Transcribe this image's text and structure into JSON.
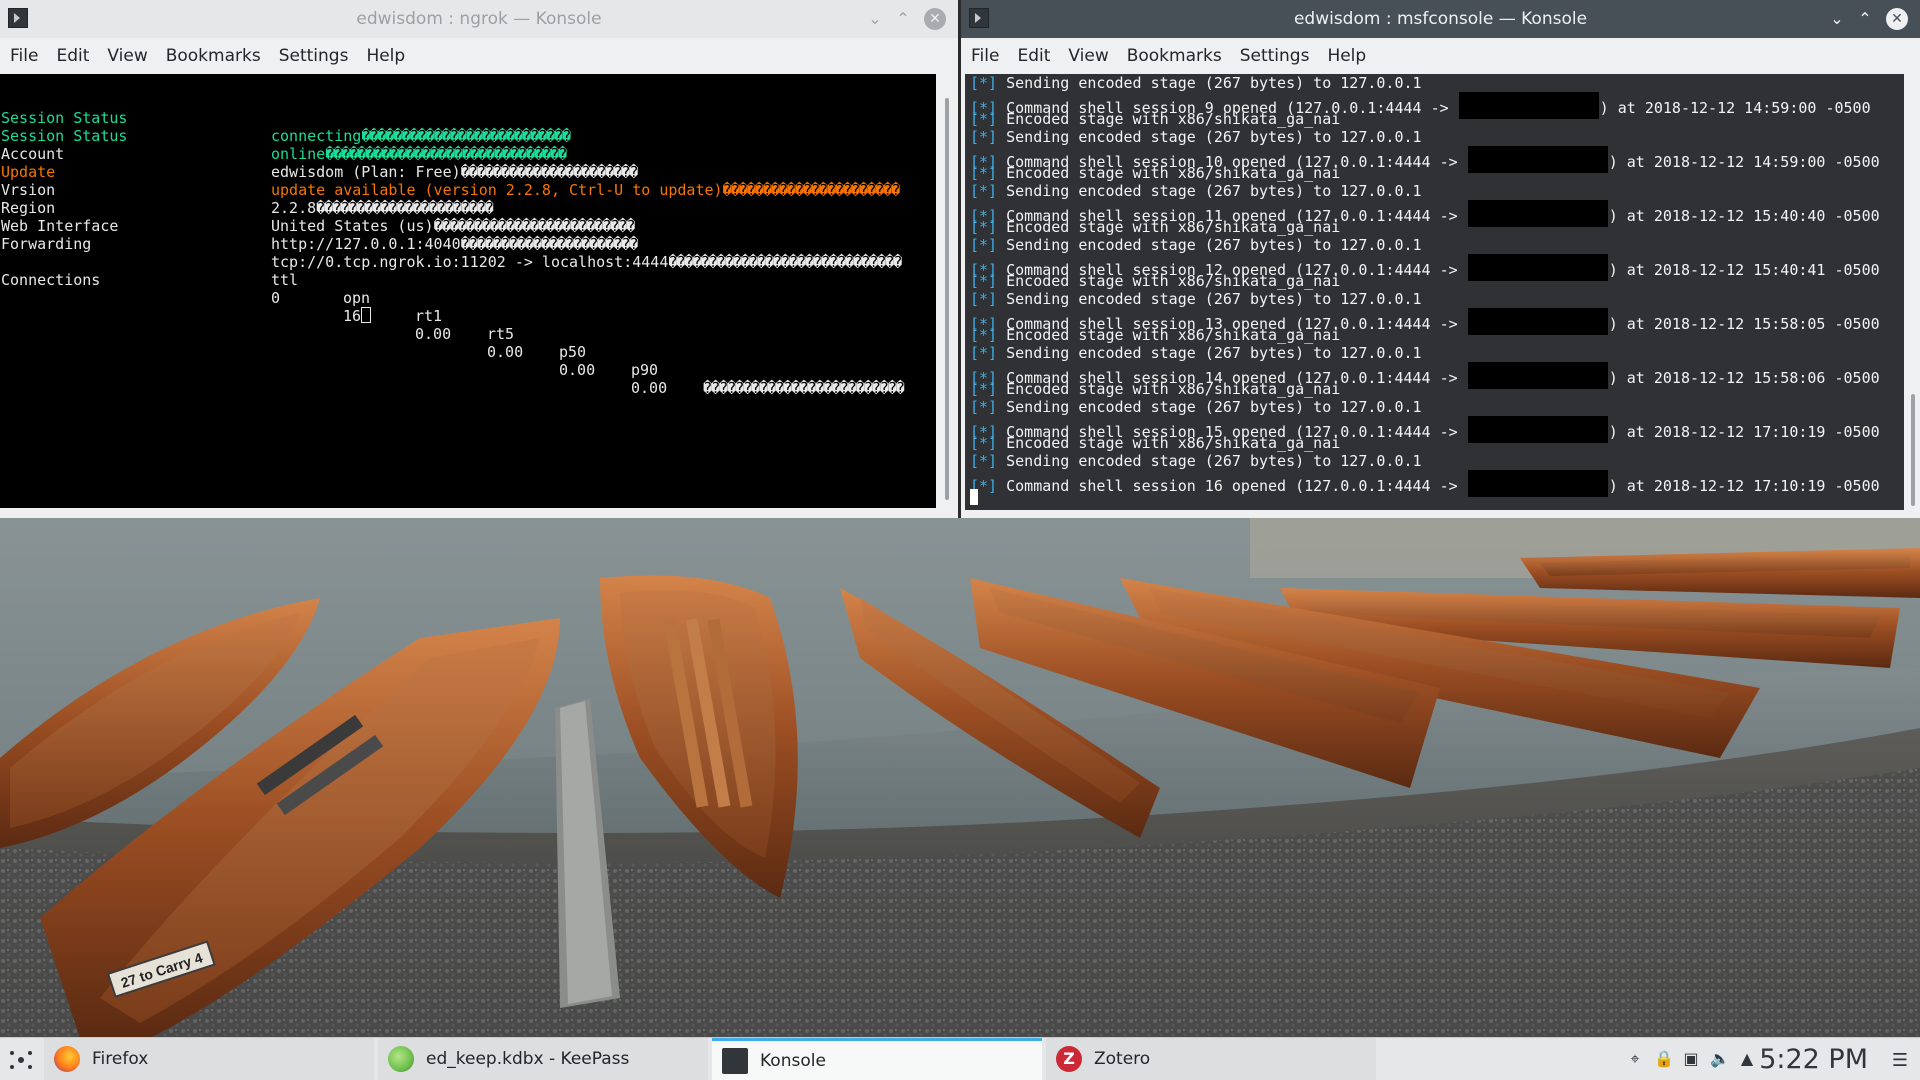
{
  "left_window": {
    "title": "edwisdom : ngrok — Konsole",
    "menu": [
      "File",
      "Edit",
      "View",
      "Bookmarks",
      "Settings",
      "Help"
    ],
    "ngrok": {
      "rows": [
        {
          "label": "Session Status",
          "value": "connecting",
          "fill": "��������������������������",
          "style": "green"
        },
        {
          "label": "Session Status",
          "value": "online",
          "fill": "������������������������������",
          "style": "green"
        },
        {
          "label": "Account",
          "value": "edwisdom (Plan: Free)",
          "fill": "����������������������",
          "style": "normal"
        },
        {
          "label": "Update",
          "value": "update available (version 2.2.8, Ctrl-U to update)",
          "fill": "����������������������",
          "style": "orange"
        },
        {
          "label": "Vrsion",
          "value": "2.2.8",
          "fill": "����������������������",
          "style": "normal"
        },
        {
          "label": "Region",
          "value": "United States (us)",
          "fill": "�������������������������",
          "style": "normal"
        },
        {
          "label": "Web Interface",
          "value": "http://127.0.0.1:4040",
          "fill": "����������������������",
          "style": "normal"
        },
        {
          "label": "Forwarding",
          "value": "tcp://0.tcp.ngrok.io:11202 -> localhost:4444",
          "fill": "�����������������������������",
          "style": "normal"
        }
      ],
      "connections_label": "Connections",
      "conn_headers": [
        "ttl",
        "opn",
        "rt1",
        "rt5",
        "p50",
        "p90"
      ],
      "conn_tail": "�������������������������",
      "conn_values": [
        "0",
        "16",
        "0.00",
        "0.00",
        "0.00",
        "0.00"
      ]
    }
  },
  "right_window": {
    "title": "edwisdom : msfconsole — Konsole",
    "menu": [
      "File",
      "Edit",
      "View",
      "Bookmarks",
      "Settings",
      "Help"
    ],
    "marker": "[*]",
    "lines": [
      {
        "text": "Sending encoded stage (267 bytes) to 127.0.0.1"
      },
      {
        "text": "Command shell session 9 opened (127.0.0.1:4444 ->",
        "tail": ") at 2018-12-12 14:59:00 -0500"
      },
      {
        "text": "Encoded stage with x86/shikata_ga_nai"
      },
      {
        "text": "Sending encoded stage (267 bytes) to 127.0.0.1"
      },
      {
        "text": "Command shell session 10 opened (127.0.0.1:4444 ->",
        "tail": ") at 2018-12-12 14:59:00 -0500"
      },
      {
        "text": "Encoded stage with x86/shikata_ga_nai"
      },
      {
        "text": "Sending encoded stage (267 bytes) to 127.0.0.1"
      },
      {
        "text": "Command shell session 11 opened (127.0.0.1:4444 ->",
        "tail": ") at 2018-12-12 15:40:40 -0500"
      },
      {
        "text": "Encoded stage with x86/shikata_ga_nai"
      },
      {
        "text": "Sending encoded stage (267 bytes) to 127.0.0.1"
      },
      {
        "text": "Command shell session 12 opened (127.0.0.1:4444 ->",
        "tail": ") at 2018-12-12 15:40:41 -0500"
      },
      {
        "text": "Encoded stage with x86/shikata_ga_nai"
      },
      {
        "text": "Sending encoded stage (267 bytes) to 127.0.0.1"
      },
      {
        "text": "Command shell session 13 opened (127.0.0.1:4444 ->",
        "tail": ") at 2018-12-12 15:58:05 -0500"
      },
      {
        "text": "Encoded stage with x86/shikata_ga_nai"
      },
      {
        "text": "Sending encoded stage (267 bytes) to 127.0.0.1"
      },
      {
        "text": "Command shell session 14 opened (127.0.0.1:4444 ->",
        "tail": ") at 2018-12-12 15:58:06 -0500"
      },
      {
        "text": "Encoded stage with x86/shikata_ga_nai"
      },
      {
        "text": "Sending encoded stage (267 bytes) to 127.0.0.1"
      },
      {
        "text": "Command shell session 15 opened (127.0.0.1:4444 ->",
        "tail": ") at 2018-12-12 17:10:19 -0500"
      },
      {
        "text": "Encoded stage with x86/shikata_ga_nai"
      },
      {
        "text": "Sending encoded stage (267 bytes) to 127.0.0.1"
      },
      {
        "text": "Command shell session 16 opened (127.0.0.1:4444 ->",
        "tail": ") at 2018-12-12 17:10:19 -0500"
      }
    ]
  },
  "wallpaper": {
    "boat_sign": "27 to Carry 4"
  },
  "taskbar": {
    "tasks": [
      {
        "label": "Firefox",
        "icon": "firefox-icon",
        "color": "#ff7a1a"
      },
      {
        "label": "ed_keep.kdbx - KeePass",
        "icon": "keepass-icon",
        "color": "#6cc04a"
      },
      {
        "label": "Konsole",
        "icon": "konsole-icon",
        "color": "#31363b"
      },
      {
        "label": "Zotero",
        "icon": "zotero-icon",
        "color": "#cc2936"
      }
    ],
    "tray_icons": [
      "network-icon",
      "lock-icon",
      "clipboard-icon",
      "volume-icon",
      "expand-arrow-icon"
    ],
    "clock": "5:22 PM"
  }
}
